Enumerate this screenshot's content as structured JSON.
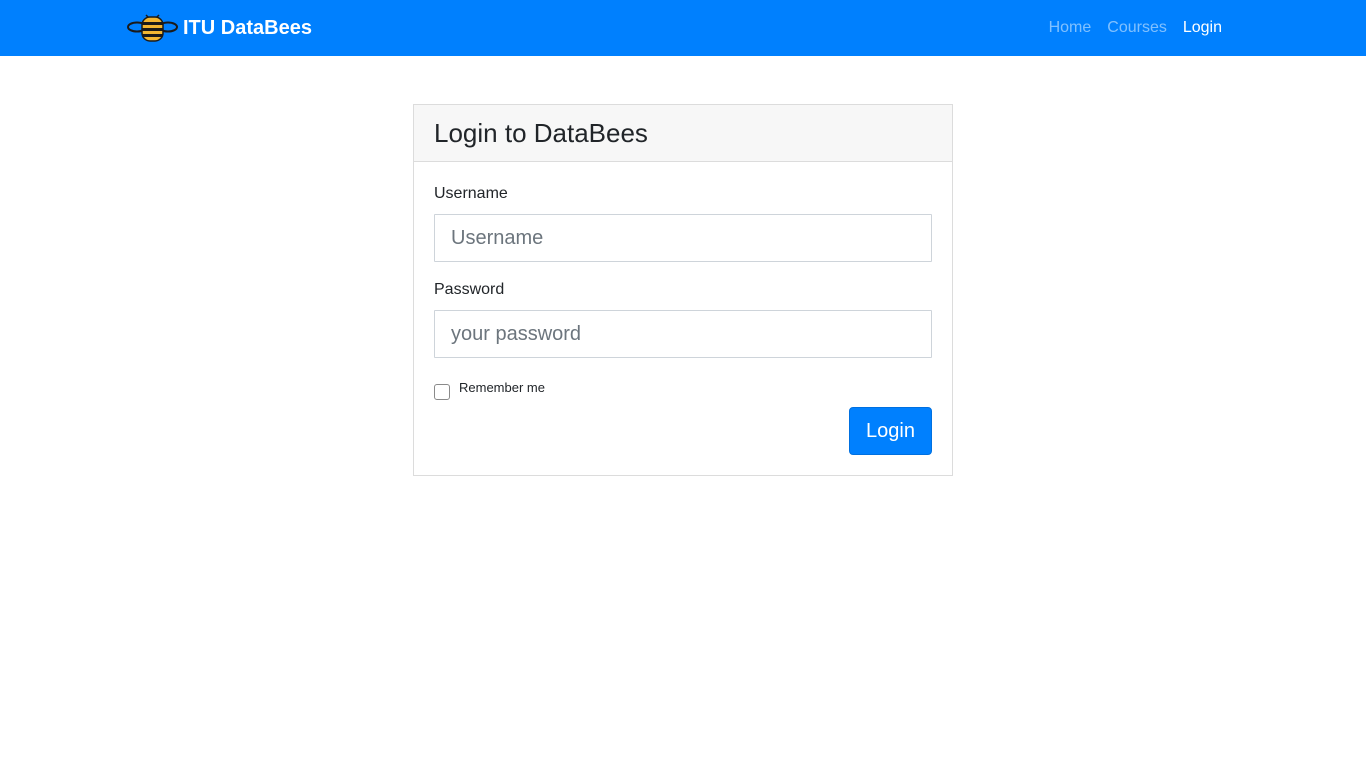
{
  "navbar": {
    "brand": "ITU DataBees",
    "logo_icon": "bee-icon",
    "links": [
      {
        "label": "Home",
        "active": false
      },
      {
        "label": "Courses",
        "active": false
      },
      {
        "label": "Login",
        "active": true
      }
    ],
    "background": "#0080fe"
  },
  "login_card": {
    "title": "Login to DataBees",
    "username": {
      "label": "Username",
      "placeholder": "Username",
      "value": ""
    },
    "password": {
      "label": "Password",
      "placeholder": "your password",
      "value": ""
    },
    "remember_me": {
      "label": "Remember me",
      "checked": false
    },
    "submit_label": "Login"
  },
  "colors": {
    "primary": "#0080fe",
    "card_header_bg": "#f7f7f7",
    "border": "#dcdcdc"
  }
}
